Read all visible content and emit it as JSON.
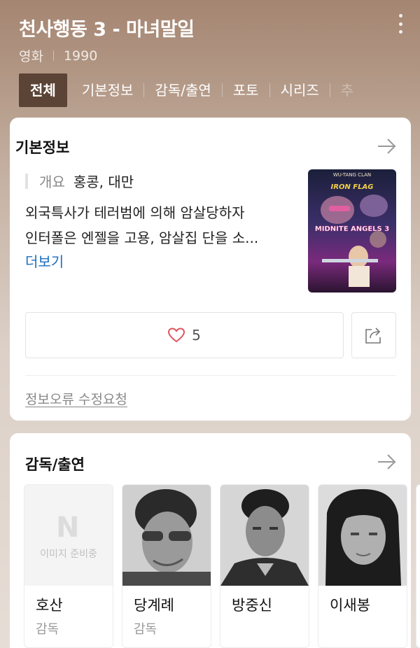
{
  "header": {
    "title": "천사행동 3 - 마녀말일",
    "genre": "영화",
    "year": "1990"
  },
  "tabs": [
    {
      "label": "전체",
      "active": true
    },
    {
      "label": "기본정보"
    },
    {
      "label": "감독/출연"
    },
    {
      "label": "포토"
    },
    {
      "label": "시리즈"
    },
    {
      "label": "추"
    }
  ],
  "basic_info": {
    "title": "기본정보",
    "summary_key": "개요",
    "summary_value": "홍콩, 대만",
    "description_line1": "외국특사가 테러범에 의해 암살당하자",
    "description_line2": "인터폴은 엔젤을 고용, 암살집 단을 소...",
    "more_label": "더보기",
    "poster": {
      "top_text": "WU-TANG CLAN",
      "logo_text": "IRON FLAG",
      "title_text": "MIDNITE ANGELS 3"
    },
    "like_count": "5",
    "report_label": "정보오류 수정요청"
  },
  "cast": {
    "title": "감독/출연",
    "placeholder_text": "이미지 준비중",
    "people": [
      {
        "name": "호산",
        "role": "감독",
        "has_photo": false
      },
      {
        "name": "당계례",
        "role": "감독",
        "has_photo": true
      },
      {
        "name": "방중신",
        "role": "",
        "has_photo": true
      },
      {
        "name": "이새봉",
        "role": "",
        "has_photo": true
      }
    ]
  },
  "colors": {
    "active_tab": "#5b4336",
    "link": "#1a6ec1",
    "heart": "#e0555f"
  }
}
